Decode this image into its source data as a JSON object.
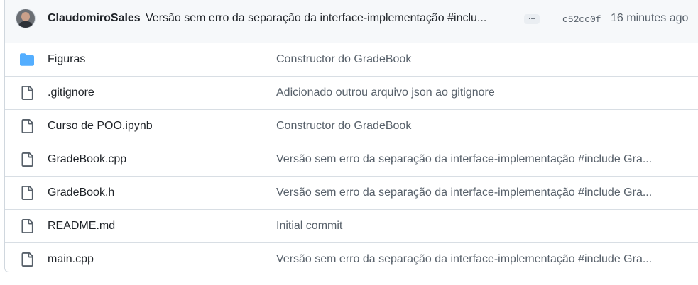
{
  "commit": {
    "author": "ClaudomiroSales",
    "message": "Versão sem erro da separação da interface-implementação #inclu...",
    "ellipsis_label": "...",
    "sha": "c52cc0f",
    "time": "16 minutes ago"
  },
  "files": [
    {
      "type": "folder",
      "name": "Figuras",
      "message": "Constructor do GradeBook"
    },
    {
      "type": "file",
      "name": ".gitignore",
      "message": "Adicionado outrou arquivo json ao gitignore"
    },
    {
      "type": "file",
      "name": "Curso de POO.ipynb",
      "message": "Constructor do GradeBook"
    },
    {
      "type": "file",
      "name": "GradeBook.cpp",
      "message": "Versão sem erro da separação da interface-implementação #include Gra..."
    },
    {
      "type": "file",
      "name": "GradeBook.h",
      "message": "Versão sem erro da separação da interface-implementação #include Gra..."
    },
    {
      "type": "file",
      "name": "README.md",
      "message": "Initial commit"
    },
    {
      "type": "file",
      "name": "main.cpp",
      "message": "Versão sem erro da separação da interface-implementação #include Gra..."
    }
  ],
  "colors": {
    "folder": "#54aeff",
    "file_icon": "#57606a"
  }
}
